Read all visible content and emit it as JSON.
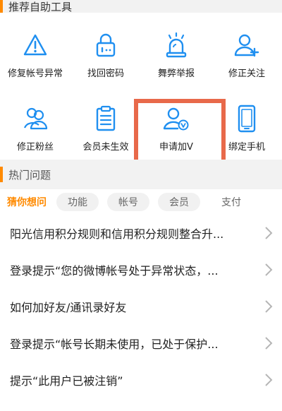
{
  "tools_section": {
    "title": "推荐自助工具"
  },
  "tools": [
    {
      "label": "修复帐号异常",
      "icon": "warning-icon"
    },
    {
      "label": "找回密码",
      "icon": "lock-icon"
    },
    {
      "label": "舞弊举报",
      "icon": "alarm-siren-icon"
    },
    {
      "label": "修正关注",
      "icon": "user-add-icon"
    },
    {
      "label": "修正粉丝",
      "icon": "users-icon"
    },
    {
      "label": "会员未生效",
      "icon": "clipboard-icon"
    },
    {
      "label": "申请加V",
      "icon": "user-verified-icon"
    },
    {
      "label": "绑定手机",
      "icon": "phone-icon"
    }
  ],
  "hot_section": {
    "title": "热门问题"
  },
  "chips": [
    {
      "label": "猜你想问",
      "active": true
    },
    {
      "label": "功能",
      "active": false
    },
    {
      "label": "帐号",
      "active": false
    },
    {
      "label": "会员",
      "active": false
    },
    {
      "label": "支付",
      "active": false
    }
  ],
  "questions": [
    {
      "text": "阳光信用积分规则和信用积分规则整合升..."
    },
    {
      "text": "登录提示“您的微博帐号处于异常状态，..."
    },
    {
      "text": "如何加好友/通讯录好友"
    },
    {
      "text": "登录提示“帐号长期未使用，已处于保护..."
    },
    {
      "text": "提示“此用户已被注销”"
    }
  ],
  "colors": {
    "accent": "#ff8a00",
    "icon": "#1f8ff0",
    "highlight": "#e8694a"
  }
}
